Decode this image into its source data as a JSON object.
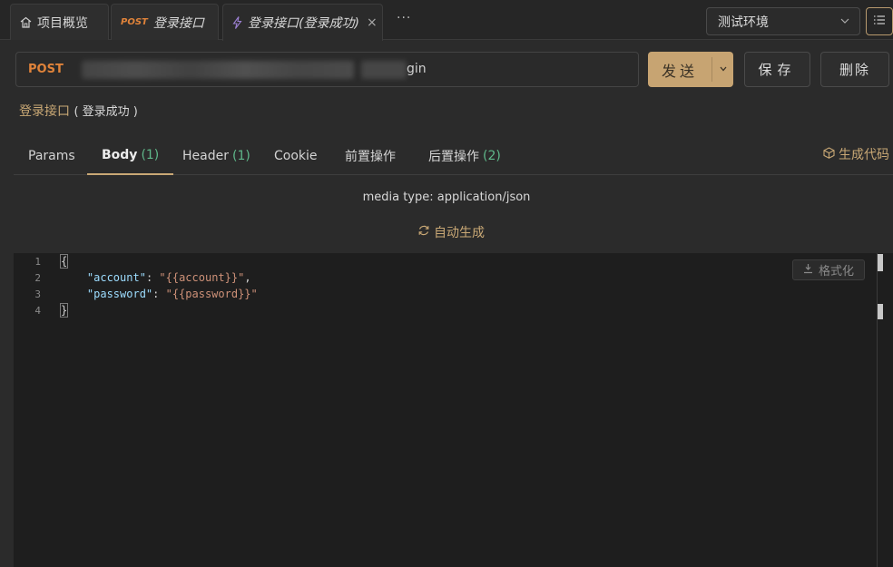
{
  "tabs": [
    {
      "label": "项目概览",
      "icon": "home-icon"
    },
    {
      "method": "POST",
      "label": "登录接口",
      "icon": "post-method-icon"
    },
    {
      "label": "登录接口(登录成功)",
      "icon": "lightning-icon",
      "close": "×"
    }
  ],
  "tabs_more": "···",
  "environment": {
    "selected": "测试环境"
  },
  "request": {
    "method": "POST",
    "url_visible_tail": "gin"
  },
  "buttons": {
    "send": "发送",
    "save": "保存",
    "delete": "删除"
  },
  "api_title": {
    "name": "登录接口",
    "case": "( 登录成功 )"
  },
  "request_tabs": [
    {
      "label": "Params",
      "count": ""
    },
    {
      "label": "Body",
      "count": "(1)"
    },
    {
      "label": "Header",
      "count": "(1)"
    },
    {
      "label": "Cookie",
      "count": ""
    },
    {
      "label": "前置操作",
      "count": ""
    },
    {
      "label": "后置操作",
      "count": "(2)"
    }
  ],
  "generate_code": "生成代码",
  "body": {
    "media_type": "media type: application/json",
    "auto_generate": "自动生成",
    "format_button": "格式化",
    "line_numbers": [
      "1",
      "2",
      "3",
      "4"
    ],
    "lines": [
      {
        "open": "{"
      },
      {
        "key": "\"account\"",
        "colon": ": ",
        "value": "\"{{account}}\"",
        "trail": ","
      },
      {
        "key": "\"password\"",
        "colon": ": ",
        "value": "\"{{password}}\"",
        "trail": ""
      },
      {
        "close": "}"
      }
    ]
  },
  "colors": {
    "accent": "#c9a875",
    "method_post": "#e0833a",
    "count_green": "#5fb88a",
    "json_key": "#9cdcfe",
    "json_string": "#ce9178"
  }
}
